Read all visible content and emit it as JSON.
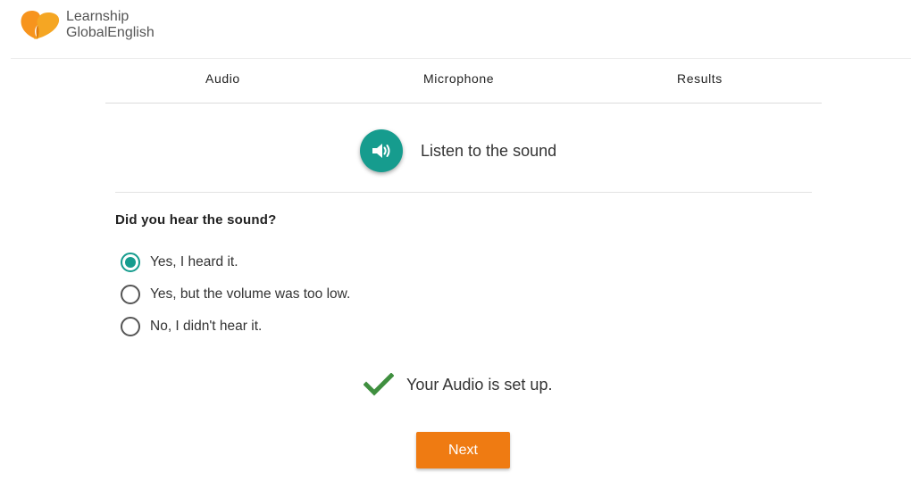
{
  "brand": {
    "line1": "Learnship",
    "line2": "GlobalEnglish",
    "colors": {
      "orange": "#f7941d",
      "teal": "#169c8e"
    }
  },
  "steps": [
    {
      "label": "Audio"
    },
    {
      "label": "Microphone"
    },
    {
      "label": "Results"
    }
  ],
  "listen": {
    "icon": "speaker-icon",
    "label": "Listen to the sound"
  },
  "question": {
    "text": "Did you hear the sound?",
    "options": [
      {
        "label": "Yes, I heard it.",
        "selected": true
      },
      {
        "label": "Yes, but the volume was too low.",
        "selected": false
      },
      {
        "label": "No, I didn't hear it.",
        "selected": false
      }
    ]
  },
  "status": {
    "icon": "checkmark-icon",
    "text": "Your Audio is set up."
  },
  "actions": {
    "next_label": "Next",
    "next_color": "#ef7b12"
  }
}
